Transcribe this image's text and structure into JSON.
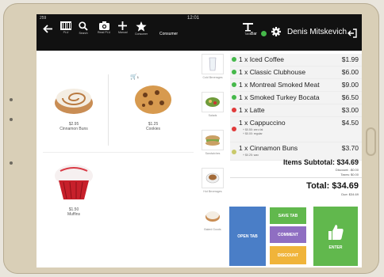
{
  "status": {
    "signal": "259",
    "time": "12:01"
  },
  "toolbar": {
    "items": [
      {
        "label": "PLU"
      },
      {
        "label": "Search"
      },
      {
        "label": "Read PLU"
      },
      {
        "label": "Manual"
      },
      {
        "label": "Consumer"
      }
    ],
    "consumer_label": "Consumer",
    "table_label": "Table",
    "bar_label": "Bar",
    "user_name": "Denis Mitskevich"
  },
  "cart": {
    "count": "1"
  },
  "products": [
    {
      "price": "$2.95",
      "name": "Cinnamon Buns"
    },
    {
      "price": "$1.25",
      "name": "Cookies"
    },
    {
      "price": "$1.50",
      "name": "Muffins"
    }
  ],
  "categories": [
    {
      "label": "Cold Beverages"
    },
    {
      "label": "Salads"
    },
    {
      "label": "Sandwiches"
    },
    {
      "label": "Hot Beverages"
    },
    {
      "label": "Baked Goods"
    }
  ],
  "order": {
    "lines": [
      {
        "item": "1 x Iced Coffee",
        "price": "$1.99",
        "dot": "#45b84a"
      },
      {
        "item": "1 x Classic Clubhouse",
        "price": "$6.00",
        "dot": "#45b84a"
      },
      {
        "item": "1 x Montreal Smoked Meat",
        "price": "$9.00",
        "dot": "#45b84a"
      },
      {
        "item": "1 x Smoked Turkey Bocata",
        "price": "$6.50",
        "dot": "#45b84a"
      },
      {
        "item": "1 x Latte",
        "price": "$3.00",
        "dot": "#e03a3a"
      },
      {
        "item": "1 x Cappuccino",
        "price": "$4.50",
        "dot": "#e03a3a",
        "mods": [
          "+ $0.50: zero fat",
          "+ $0.00: regular"
        ]
      },
      {
        "item": "1 x Cinnamon Buns",
        "price": "$3.70",
        "dot": "#c9c96a",
        "mods": [
          "+ $0.25: wax"
        ]
      }
    ],
    "subtotal": "Items Subtotal: $34.69",
    "discount": "Discount: -$0.00",
    "taxes": "Taxes: $0.00",
    "total": "Total: $34.69",
    "due": "Due: $34.69"
  },
  "buttons": {
    "open_tab": "OPEN TAB",
    "save_tab": "SAVE TAB",
    "comment": "COMMENT",
    "discount": "DISCOUNT",
    "enter": "ENTER"
  },
  "colors": {
    "toolbar": "#111111",
    "open_tab": "#4a7ec7",
    "save_tab": "#61b84d",
    "comment": "#8f6ec2",
    "discount": "#f0b43a",
    "enter": "#61b84d",
    "tablet_frame": "#d9cfb7"
  }
}
